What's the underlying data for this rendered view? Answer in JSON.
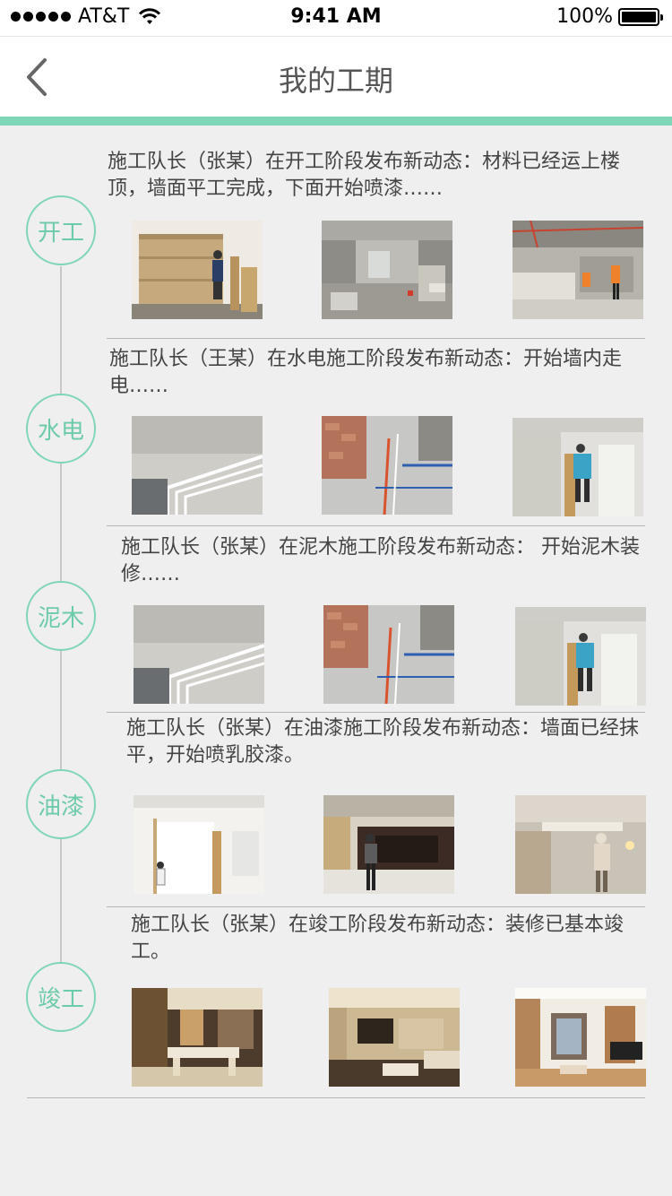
{
  "status_bar": {
    "carrier": "AT&T",
    "time": "9:41 AM",
    "battery": "100%"
  },
  "nav": {
    "title": "我的工期",
    "back_icon": "chevron-left-icon"
  },
  "accent_color": "#7fd6b7",
  "stages": [
    {
      "label": "开工",
      "update": "施工队长（张某）在开工阶段发布新动态：材料已经运上楼顶，墙面平工完成，下面开始喷漆……",
      "photos": [
        "wood-panel-wall-worker-photo",
        "rough-room-debris-photo",
        "site-workers-orange-photo"
      ]
    },
    {
      "label": "水电",
      "update": "施工队长（王某）在水电施工阶段发布新动态：开始墙内走电……",
      "photos": [
        "wall-conduit-pipes-photo",
        "floor-wiring-bricks-photo",
        "worker-ladder-wall-photo"
      ]
    },
    {
      "label": "泥木",
      "update": "施工队长（张某）在泥木施工阶段发布新动态： 开始泥木装修……",
      "photos": [
        "wall-conduit-pipes-photo",
        "floor-wiring-bricks-photo",
        "worker-ladder-wall-photo"
      ]
    },
    {
      "label": "油漆",
      "update": "施工队长（张某）在油漆施工阶段发布新动态：墙面已经抹平，开始喷乳胶漆。",
      "photos": [
        "white-room-painting-photo",
        "tv-wall-painting-photo",
        "ceiling-painting-worker-photo"
      ]
    },
    {
      "label": "竣工",
      "update": "施工队长（张某）在竣工阶段发布新动态：装修已基本竣工。",
      "photos": [
        "dining-room-finished-photo",
        "living-room-finished-photo",
        "study-room-piano-photo"
      ]
    }
  ]
}
